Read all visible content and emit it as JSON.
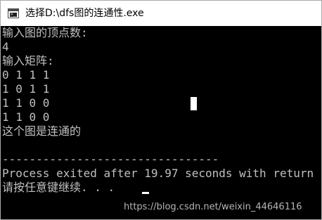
{
  "window": {
    "title": "选择D:\\dfs图的连通性.exe",
    "icon": "console-app-icon",
    "prompt_glyph": ">_"
  },
  "console": {
    "lines": [
      "输入图的顶点数:",
      "4",
      "输入矩阵:",
      "0 1 1 1",
      "1 0 1 1",
      "1 1 0 0",
      "1 1 0 0",
      "这个图是连通的",
      "",
      "--------------------------------",
      "Process exited after 19.97 seconds with return",
      "请按任意键继续. . ."
    ]
  },
  "watermark": {
    "text": "https://blog.csdn.net/weixin_44646116"
  },
  "colors": {
    "console_background": "#000000",
    "console_text": "#c0c0c0",
    "titlebar_background": "#ffffff",
    "watermark": "#b5b5b5"
  }
}
